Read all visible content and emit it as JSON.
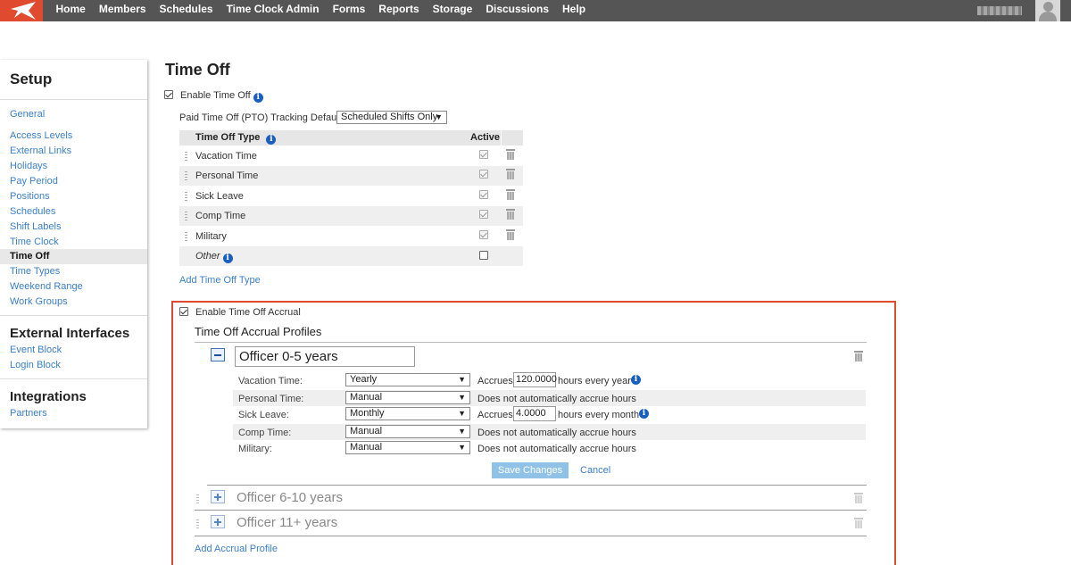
{
  "nav": {
    "items": [
      "Home",
      "Members",
      "Schedules",
      "Time Clock Admin",
      "Forms",
      "Reports",
      "Storage",
      "Discussions",
      "Help"
    ]
  },
  "colors": {
    "brand": "#e04a2f",
    "nav_bg": "#555555",
    "link": "#3b7fc4",
    "info": "#1a5fc0",
    "save_button": "#8fc2e6"
  },
  "sidebar": {
    "setup_title": "Setup",
    "general": "General",
    "items": [
      "Access Levels",
      "External Links",
      "Holidays",
      "Pay Period",
      "Positions",
      "Schedules",
      "Shift Labels",
      "Time Clock",
      "Time Off",
      "Time Types",
      "Weekend Range",
      "Work Groups"
    ],
    "active_item": "Time Off",
    "external_title": "External Interfaces",
    "external_items": [
      "Event Block",
      "Login Block"
    ],
    "integrations_title": "Integrations",
    "integrations_items": [
      "Partners"
    ]
  },
  "page": {
    "title": "Time Off",
    "enable_time_off": "Enable Time Off",
    "enable_time_off_checked": true,
    "pto_label": "Paid Time Off (PTO) Tracking Default:",
    "pto_value": "Scheduled Shifts Only"
  },
  "types_table": {
    "col_type": "Time Off Type",
    "col_active": "Active",
    "rows": [
      {
        "name": "Vacation Time",
        "active": true
      },
      {
        "name": "Personal Time",
        "active": true
      },
      {
        "name": "Sick Leave",
        "active": true
      },
      {
        "name": "Comp Time",
        "active": true
      },
      {
        "name": "Military",
        "active": true
      },
      {
        "name": "Other",
        "active": false
      }
    ],
    "add_link": "Add Time Off Type"
  },
  "accrual": {
    "enable_label": "Enable Time Off Accrual",
    "enabled": true,
    "profiles_title": "Time Off Accrual Profiles",
    "expanded_profile": {
      "name": "Officer 0-5 years",
      "rows": [
        {
          "label": "Vacation Time:",
          "frequency": "Yearly",
          "accrues": "Accrues",
          "amount": "120.0000",
          "suffix": "hours every year",
          "info": true
        },
        {
          "label": "Personal Time:",
          "frequency": "Manual",
          "note": "Does not automatically accrue hours"
        },
        {
          "label": "Sick Leave:",
          "frequency": "Monthly",
          "accrues": "Accrues",
          "amount": "4.0000",
          "suffix": "hours every month",
          "info": true
        },
        {
          "label": "Comp Time:",
          "frequency": "Manual",
          "note": "Does not automatically accrue hours"
        },
        {
          "label": "Military:",
          "frequency": "Manual",
          "note": "Does not automatically accrue hours"
        }
      ],
      "save_label": "Save Changes",
      "cancel_label": "Cancel"
    },
    "collapsed_profiles": [
      "Officer 6-10 years",
      "Officer 11+ years"
    ],
    "add_profile": "Add Accrual Profile"
  },
  "icons": [
    "logo-icon",
    "avatar-icon",
    "info-icon",
    "trash-icon",
    "drag-handle-icon",
    "collapse-icon",
    "expand-icon",
    "dropdown-arrow-icon"
  ]
}
